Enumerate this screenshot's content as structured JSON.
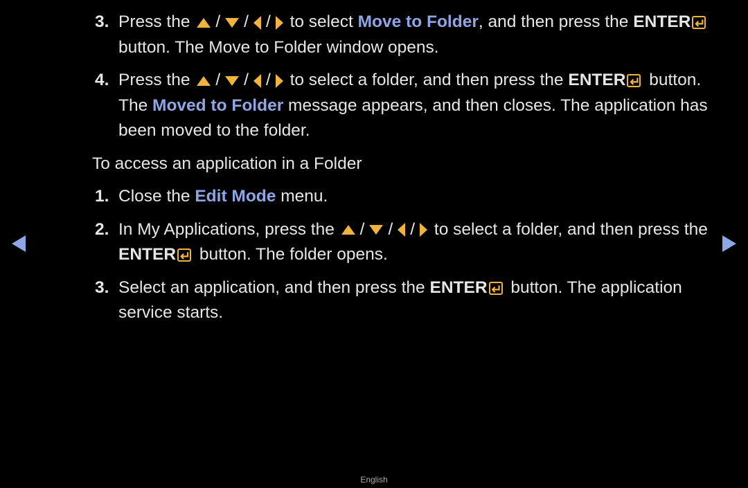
{
  "steps_a": [
    {
      "num": "3.",
      "pre": "Press the",
      "mid": "to select",
      "link": "Move to Folder",
      "post": ", and then press the",
      "enter": "ENTER",
      "tail": "button. The Move to Folder window opens."
    },
    {
      "num": "4.",
      "pre": "Press the",
      "mid": "to select a folder, and then press the",
      "enter": "ENTER",
      "tail_pre": "button. The",
      "link": "Moved to Folder",
      "tail": "message appears, and then closes. The application has been moved to the folder."
    }
  ],
  "section_heading": "To access an application in a Folder",
  "steps_b": [
    {
      "num": "1.",
      "pre": "Close the",
      "link": "Edit Mode",
      "post": "menu."
    },
    {
      "num": "2.",
      "pre": "In My Applications, press the",
      "mid": "to select a folder, and then press the",
      "enter": "ENTER",
      "tail": "button. The folder opens."
    },
    {
      "num": "3.",
      "pre": "Select an application, and then press the",
      "enter": "ENTER",
      "tail": "button. The application service starts."
    }
  ],
  "separator": "/",
  "nav": {
    "prev": "previous-page",
    "next": "next-page"
  },
  "footer": "English",
  "colors": {
    "accent": "#8fa6e6",
    "icon": "#f0b43c",
    "text": "#e6e6e6",
    "background": "#000000"
  }
}
